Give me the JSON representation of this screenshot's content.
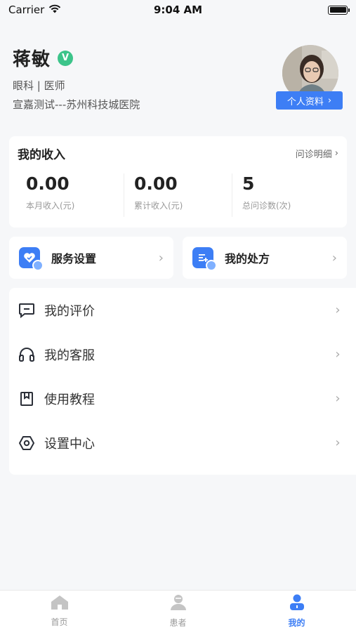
{
  "status_bar": {
    "carrier": "Carrier",
    "time": "9:04 AM"
  },
  "profile": {
    "name": "蒋敏",
    "verified_badge": "V",
    "department_title": "眼科 | 医师",
    "hospital": "宣嘉测试---苏州科技城医院",
    "profile_button": "个人资料"
  },
  "income": {
    "title": "我的收入",
    "detail_link": "问诊明细",
    "stats": [
      {
        "value": "0.00",
        "label": "本月收入(元)"
      },
      {
        "value": "0.00",
        "label": "累计收入(元)"
      },
      {
        "value": "5",
        "label": "总问诊数(次)"
      }
    ]
  },
  "quick_actions": [
    {
      "label": "服务设置",
      "icon": "heart-shield-icon"
    },
    {
      "label": "我的处方",
      "icon": "prescription-icon"
    }
  ],
  "menu": [
    {
      "label": "我的评价",
      "icon": "comment-icon"
    },
    {
      "label": "我的客服",
      "icon": "headset-icon"
    },
    {
      "label": "使用教程",
      "icon": "bookmark-book-icon"
    },
    {
      "label": "设置中心",
      "icon": "settings-hex-icon"
    }
  ],
  "tabbar": [
    {
      "label": "首页",
      "icon": "home-icon",
      "active": false
    },
    {
      "label": "患者",
      "icon": "patient-icon",
      "active": false
    },
    {
      "label": "我的",
      "icon": "user-icon",
      "active": true
    }
  ],
  "colors": {
    "accent": "#3d7ef5",
    "verified": "#3cc48a",
    "background": "#f6f7f9"
  }
}
